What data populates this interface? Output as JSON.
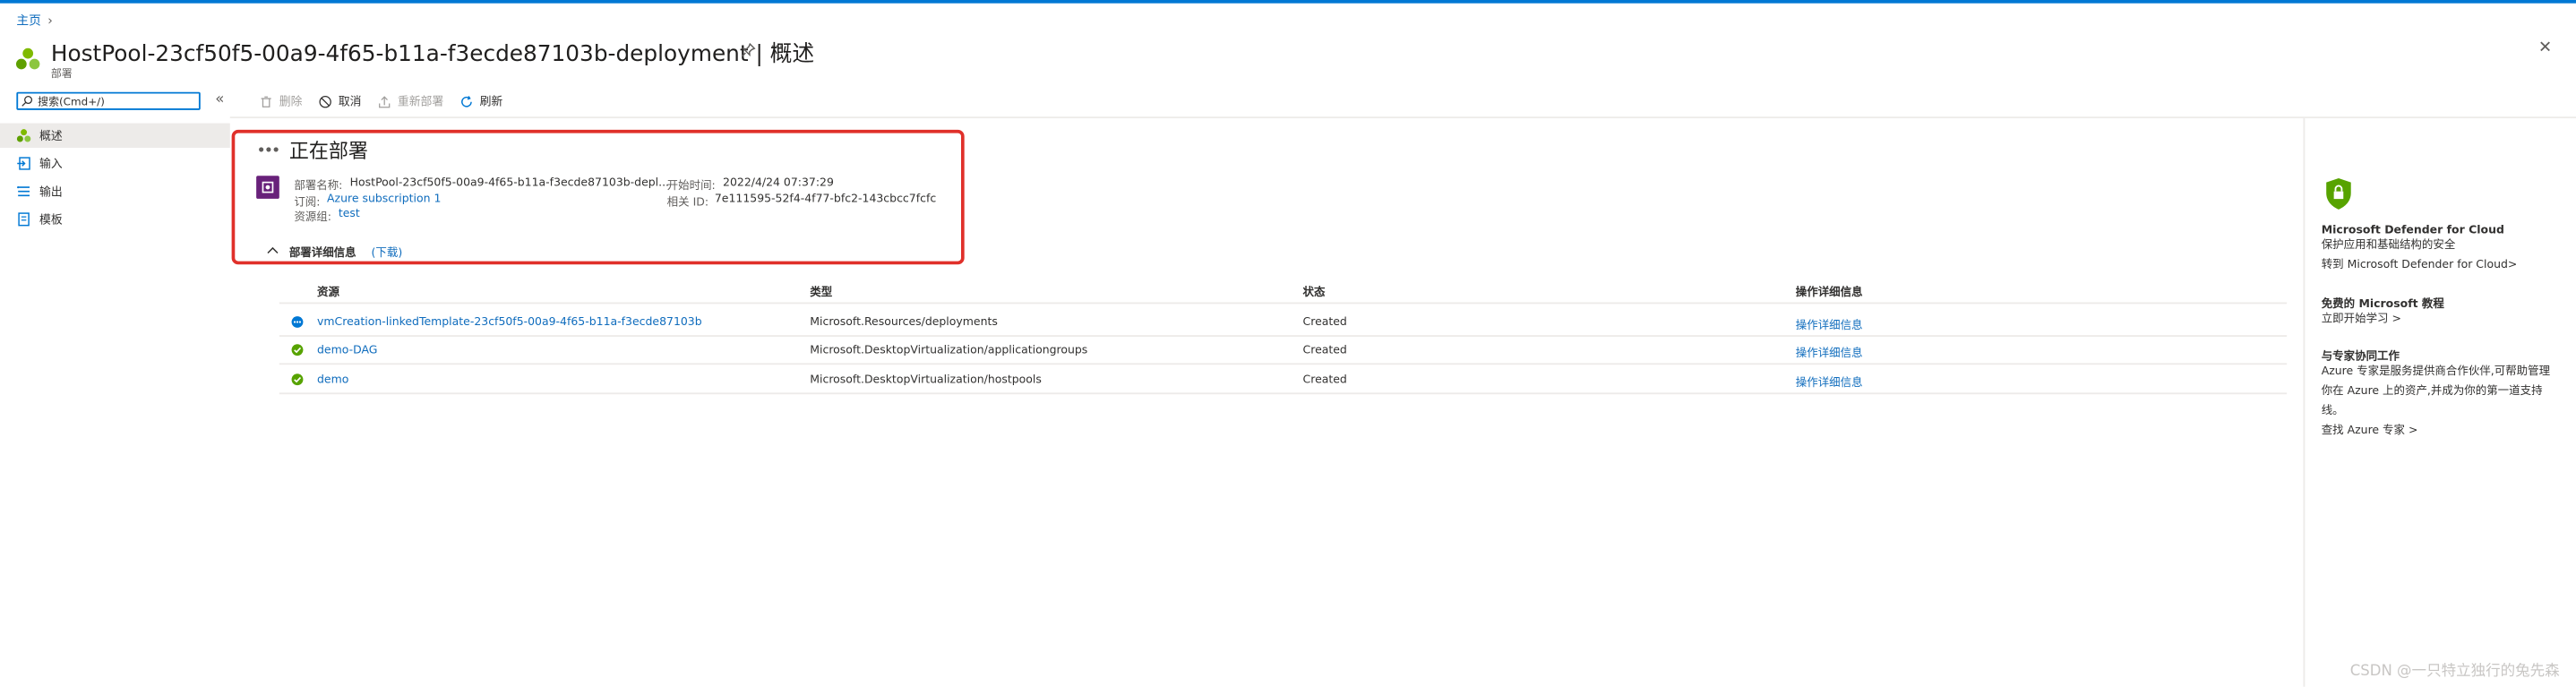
{
  "breadcrumb": {
    "home": "主页",
    "separator": "›"
  },
  "header": {
    "title": "HostPool-23cf50f5-00a9-4f65-b11a-f3ecde87103b-deployment | 概述",
    "subtitle": "部署",
    "pin_icon": "pin-icon",
    "more_label": "···",
    "close_label": "✕"
  },
  "search": {
    "placeholder": "搜索(Cmd+/)",
    "collapse_label": "«"
  },
  "sidebar": {
    "items": [
      {
        "label": "概述",
        "icon": "overview-icon"
      },
      {
        "label": "输入",
        "icon": "input-icon"
      },
      {
        "label": "输出",
        "icon": "output-icon"
      },
      {
        "label": "模板",
        "icon": "template-icon"
      }
    ]
  },
  "toolbar": {
    "delete_label": "删除",
    "cancel_label": "取消",
    "redeploy_label": "重新部署",
    "refresh_label": "刷新"
  },
  "status": {
    "heading": "正在部署",
    "name_label": "部署名称:",
    "name_value": "HostPool-23cf50f5-00a9-4f65-b11a-f3ecde87103b-depl...",
    "subscription_label": "订阅:",
    "subscription_value": "Azure subscription 1",
    "rg_label": "资源组:",
    "rg_value": "test",
    "start_label": "开始时间:",
    "start_value": "2022/4/24 07:37:29",
    "corr_label": "相关 ID:",
    "corr_value": "7e111595-52f4-4f77-bfc2-143cbcc7fcfc"
  },
  "details": {
    "title": "部署详细信息",
    "download_label": "(下载)"
  },
  "table": {
    "headers": [
      "资源",
      "类型",
      "状态",
      "操作详细信息"
    ],
    "rows": [
      {
        "resource": "vmCreation-linkedTemplate-23cf50f5-00a9-4f65-b11a-f3ecde87103b",
        "type": "Microsoft.Resources/deployments",
        "status": "Created",
        "details": "操作详细信息",
        "state": "running"
      },
      {
        "resource": "demo-DAG",
        "type": "Microsoft.DesktopVirtualization/applicationgroups",
        "status": "Created",
        "details": "操作详细信息",
        "state": "ok"
      },
      {
        "resource": "demo",
        "type": "Microsoft.DesktopVirtualization/hostpools",
        "status": "Created",
        "details": "操作详细信息",
        "state": "ok"
      }
    ]
  },
  "right_panel": {
    "defender_title": "Microsoft Defender for Cloud",
    "defender_desc": "保护应用和基础结构的安全",
    "defender_link": "转到 Microsoft Defender for Cloud>",
    "learn_title": "免费的 Microsoft 教程",
    "learn_link": "立即开始学习 >",
    "expert_title": "与专家协同工作",
    "expert_desc": "Azure 专家是服务提供商合作伙伴,可帮助管理你在 Azure 上的资产,并成为你的第一道支持线。",
    "expert_link": "查找 Azure 专家 >"
  },
  "watermark": "CSDN @一只特立独行的兔先森",
  "colors": {
    "accent": "#0078d4",
    "link": "#0f6cbd",
    "highlight_box": "#e0302a",
    "success": "#57a300",
    "deploy_icon": "#68217a",
    "shield": "#57a300"
  }
}
